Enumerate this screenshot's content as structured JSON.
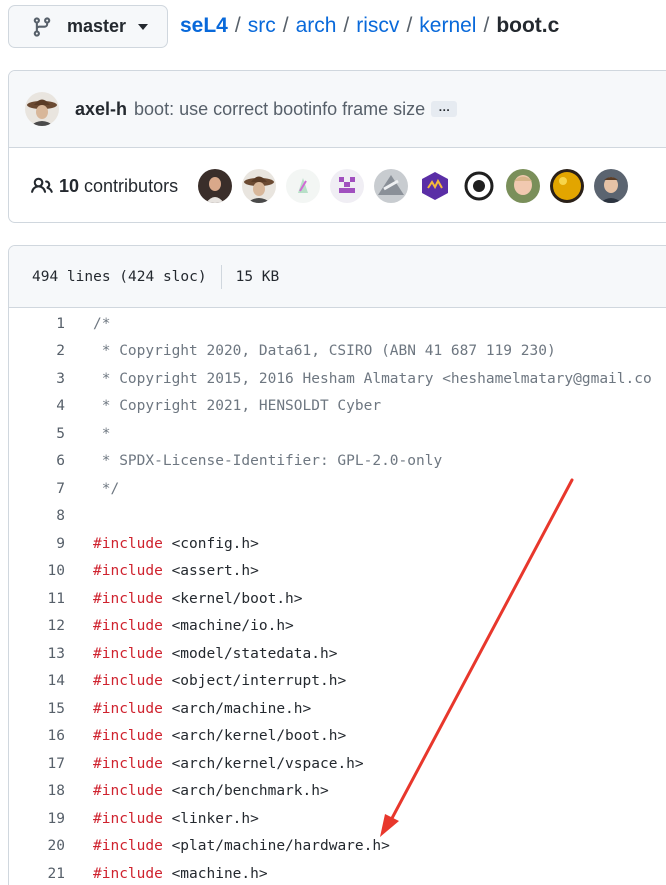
{
  "branch": {
    "name": "master"
  },
  "breadcrumb": {
    "repo": "seL4",
    "path": [
      "src",
      "arch",
      "riscv",
      "kernel"
    ],
    "file": "boot.c"
  },
  "commit": {
    "author": "axel-h",
    "message": "boot: use correct bootinfo frame size",
    "more_label": "…"
  },
  "contributors": {
    "count": "10",
    "label": "contributors"
  },
  "file": {
    "lines_info": "494 lines (424 sloc)",
    "size": "15 KB"
  },
  "code_lines": [
    {
      "n": "1",
      "text": "/*",
      "type": "comment"
    },
    {
      "n": "2",
      "text": " * Copyright 2020, Data61, CSIRO (ABN 41 687 119 230)",
      "type": "comment"
    },
    {
      "n": "3",
      "text": " * Copyright 2015, 2016 Hesham Almatary <heshamelmatary@gmail.co",
      "type": "comment"
    },
    {
      "n": "4",
      "text": " * Copyright 2021, HENSOLDT Cyber",
      "type": "comment"
    },
    {
      "n": "5",
      "text": " *",
      "type": "comment"
    },
    {
      "n": "6",
      "text": " * SPDX-License-Identifier: GPL-2.0-only",
      "type": "comment"
    },
    {
      "n": "7",
      "text": " */",
      "type": "comment"
    },
    {
      "n": "8",
      "text": "",
      "type": "blank"
    },
    {
      "n": "9",
      "kw": "#include",
      "arg": " <config.h>",
      "type": "include"
    },
    {
      "n": "10",
      "kw": "#include",
      "arg": " <assert.h>",
      "type": "include"
    },
    {
      "n": "11",
      "kw": "#include",
      "arg": " <kernel/boot.h>",
      "type": "include"
    },
    {
      "n": "12",
      "kw": "#include",
      "arg": " <machine/io.h>",
      "type": "include"
    },
    {
      "n": "13",
      "kw": "#include",
      "arg": " <model/statedata.h>",
      "type": "include"
    },
    {
      "n": "14",
      "kw": "#include",
      "arg": " <object/interrupt.h>",
      "type": "include"
    },
    {
      "n": "15",
      "kw": "#include",
      "arg": " <arch/machine.h>",
      "type": "include"
    },
    {
      "n": "16",
      "kw": "#include",
      "arg": " <arch/kernel/boot.h>",
      "type": "include"
    },
    {
      "n": "17",
      "kw": "#include",
      "arg": " <arch/kernel/vspace.h>",
      "type": "include"
    },
    {
      "n": "18",
      "kw": "#include",
      "arg": " <arch/benchmark.h>",
      "type": "include"
    },
    {
      "n": "19",
      "kw": "#include",
      "arg": " <linker.h>",
      "type": "include"
    },
    {
      "n": "20",
      "kw": "#include",
      "arg": " <plat/machine/hardware.h>",
      "type": "include"
    },
    {
      "n": "21",
      "kw": "#include",
      "arg": " <machine.h>",
      "type": "include"
    }
  ],
  "colors": {
    "link": "#0969da",
    "keyword": "#cf222e",
    "comment": "#6e7781",
    "annotation_arrow": "#e8372c"
  }
}
